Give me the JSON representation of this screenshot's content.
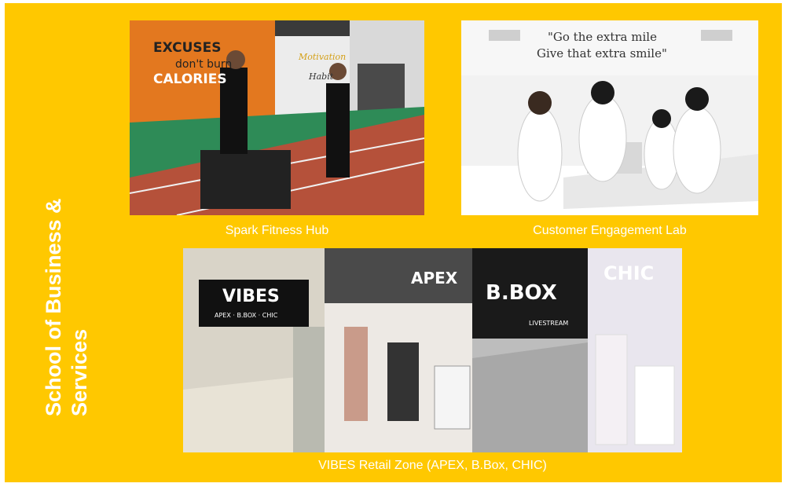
{
  "title": "School of Business & Services",
  "facilities": {
    "fitness": {
      "caption": "Spark Fitness Hub",
      "wall_text_1": "EXCUSES",
      "wall_text_2": "don't burn",
      "wall_text_3": "CALORIES",
      "wall_text_4": "Motivation",
      "wall_text_5": "Habit"
    },
    "customer": {
      "caption": "Customer Engagement Lab",
      "wall_text_1": "\"Go the extra mile",
      "wall_text_2": "Give that extra smile\""
    },
    "retail": {
      "caption": "VIBES Retail Zone (APEX, B.Box, CHIC)",
      "sign_vibes": "VIBES",
      "sign_vibes_sub": "APEX · B.BOX · CHIC",
      "sign_apex": "APEX",
      "sign_bbox": "B.BOX",
      "sign_bbox_sub": "LIVESTREAM",
      "sign_chic": "CHIC"
    }
  },
  "colors": {
    "background": "#FFC800",
    "text": "#FFFFFF"
  }
}
